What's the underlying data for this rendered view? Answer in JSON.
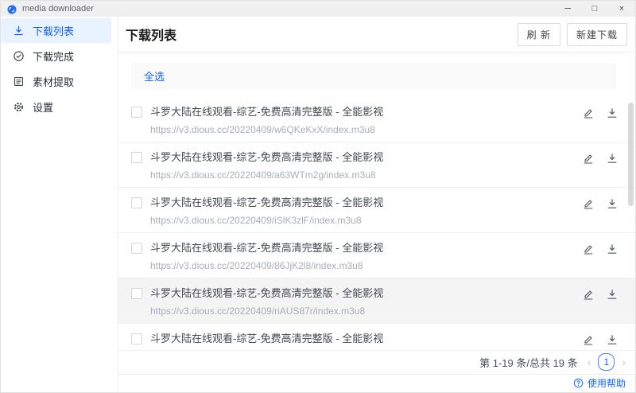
{
  "window": {
    "title": "media downloader",
    "controls": {
      "minimize": "─",
      "maximize": "□",
      "close": "×"
    }
  },
  "sidebar": {
    "items": [
      {
        "label": "下载列表",
        "icon": "download-icon",
        "active": true
      },
      {
        "label": "下载完成",
        "icon": "check-circle-icon",
        "active": false
      },
      {
        "label": "素材提取",
        "icon": "extract-icon",
        "active": false
      },
      {
        "label": "设置",
        "icon": "gear-icon",
        "active": false
      }
    ]
  },
  "main": {
    "title": "下载列表",
    "toolbar": {
      "refresh_label": "刷 新",
      "new_download_label": "新建下载"
    },
    "select_all_label": "全选",
    "items": [
      {
        "title": "斗罗大陆在线观看-综艺-免费高清完整版 - 全能影视",
        "url": "https://v3.dious.cc/20220409/w6QKeKxX/index.m3u8",
        "hover": false
      },
      {
        "title": "斗罗大陆在线观看-综艺-免费高清完整版 - 全能影视",
        "url": "https://v3.dious.cc/20220409/a63WTm2g/index.m3u8",
        "hover": false
      },
      {
        "title": "斗罗大陆在线观看-综艺-免费高清完整版 - 全能影视",
        "url": "https://v3.dious.cc/20220409/iSlK3zlF/index.m3u8",
        "hover": false
      },
      {
        "title": "斗罗大陆在线观看-综艺-免费高清完整版 - 全能影视",
        "url": "https://v3.dious.cc/20220409/86JjK2l8/index.m3u8",
        "hover": false
      },
      {
        "title": "斗罗大陆在线观看-综艺-免费高清完整版 - 全能影视",
        "url": "https://v3.dious.cc/20220409/riAUS87r/index.m3u8",
        "hover": true
      },
      {
        "title": "斗罗大陆在线观看-综艺-免费高清完整版 - 全能影视",
        "url": "",
        "hover": false
      }
    ],
    "pagination": {
      "summary": "第 1-19 条/总共 19 条",
      "prev": "‹",
      "page": "1",
      "next": "›"
    },
    "help_label": "使用帮助"
  },
  "colors": {
    "accent": "#165DFF",
    "active_bg": "#E8F3FF",
    "hover_bg": "#F4F4F5"
  }
}
